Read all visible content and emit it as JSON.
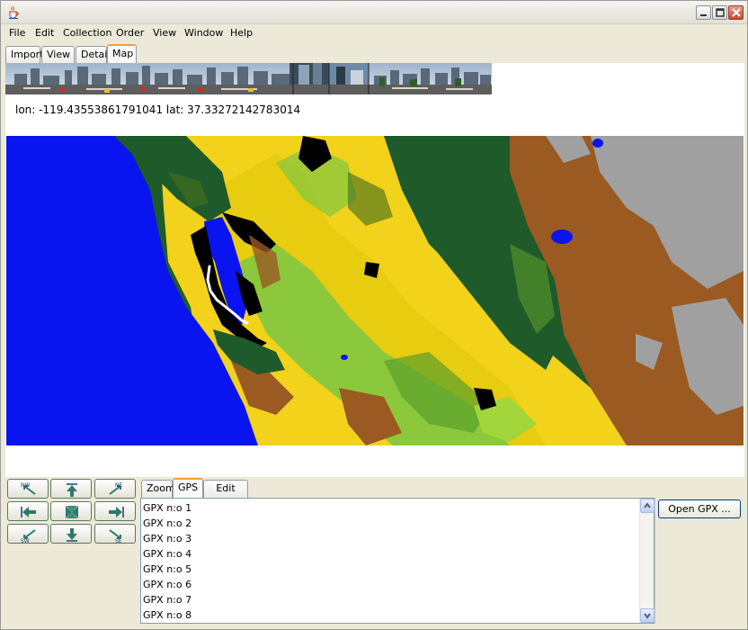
{
  "titlebar": {
    "icon": "java-cup-icon",
    "buttons": {
      "minimize": "minimize-icon",
      "maximize": "maximize-icon",
      "close": "close-icon"
    },
    "close_color": "#c8472e"
  },
  "menu": {
    "items": [
      {
        "label": "File"
      },
      {
        "label": "Edit"
      },
      {
        "label": "Collection"
      },
      {
        "label": "Order"
      },
      {
        "label": "View"
      },
      {
        "label": "Window"
      },
      {
        "label": "Help"
      }
    ]
  },
  "tabs": {
    "items": [
      {
        "label": "Import"
      },
      {
        "label": "View"
      },
      {
        "label": "Detail"
      },
      {
        "label": "Map"
      }
    ],
    "active": "Map",
    "active_color": "#f0a03c"
  },
  "coordinates": {
    "text": "lon: -119.43553861791041 lat: 37.33272142783014"
  },
  "map_colors": {
    "water": "#0a14f0",
    "forest": "#1f5a2a",
    "grass": "#f2d21a",
    "shrub": "#8cc83c",
    "desert": "#9a5a22",
    "rock": "#a0a0a0",
    "urban": "#000000",
    "track": "#ffffff"
  },
  "navigation": {
    "buttons": [
      {
        "label": "NW",
        "icon": "arrow-nw-icon"
      },
      {
        "label": "",
        "icon": "arrow-n-icon"
      },
      {
        "label": "NE",
        "icon": "arrow-ne-icon"
      },
      {
        "label": "",
        "icon": "arrow-w-icon"
      },
      {
        "label": "",
        "icon": "center-icon"
      },
      {
        "label": "",
        "icon": "arrow-e-icon"
      },
      {
        "label": "SW",
        "icon": "arrow-sw-icon"
      },
      {
        "label": "",
        "icon": "arrow-s-icon"
      },
      {
        "label": "SE",
        "icon": "arrow-se-icon"
      }
    ]
  },
  "bottom_tabs": {
    "items": [
      {
        "label": "Zoom"
      },
      {
        "label": "GPS"
      },
      {
        "label": "Edit Map"
      }
    ],
    "active": "GPS"
  },
  "gpx_list": {
    "items": [
      "GPX n:o 1",
      "GPX n:o 2",
      "GPX n:o 3",
      "GPX n:o 4",
      "GPX n:o 5",
      "GPX n:o 6",
      "GPX n:o 7",
      "GPX n:o 8"
    ]
  },
  "open_gpx": {
    "label": "Open GPX ..."
  }
}
